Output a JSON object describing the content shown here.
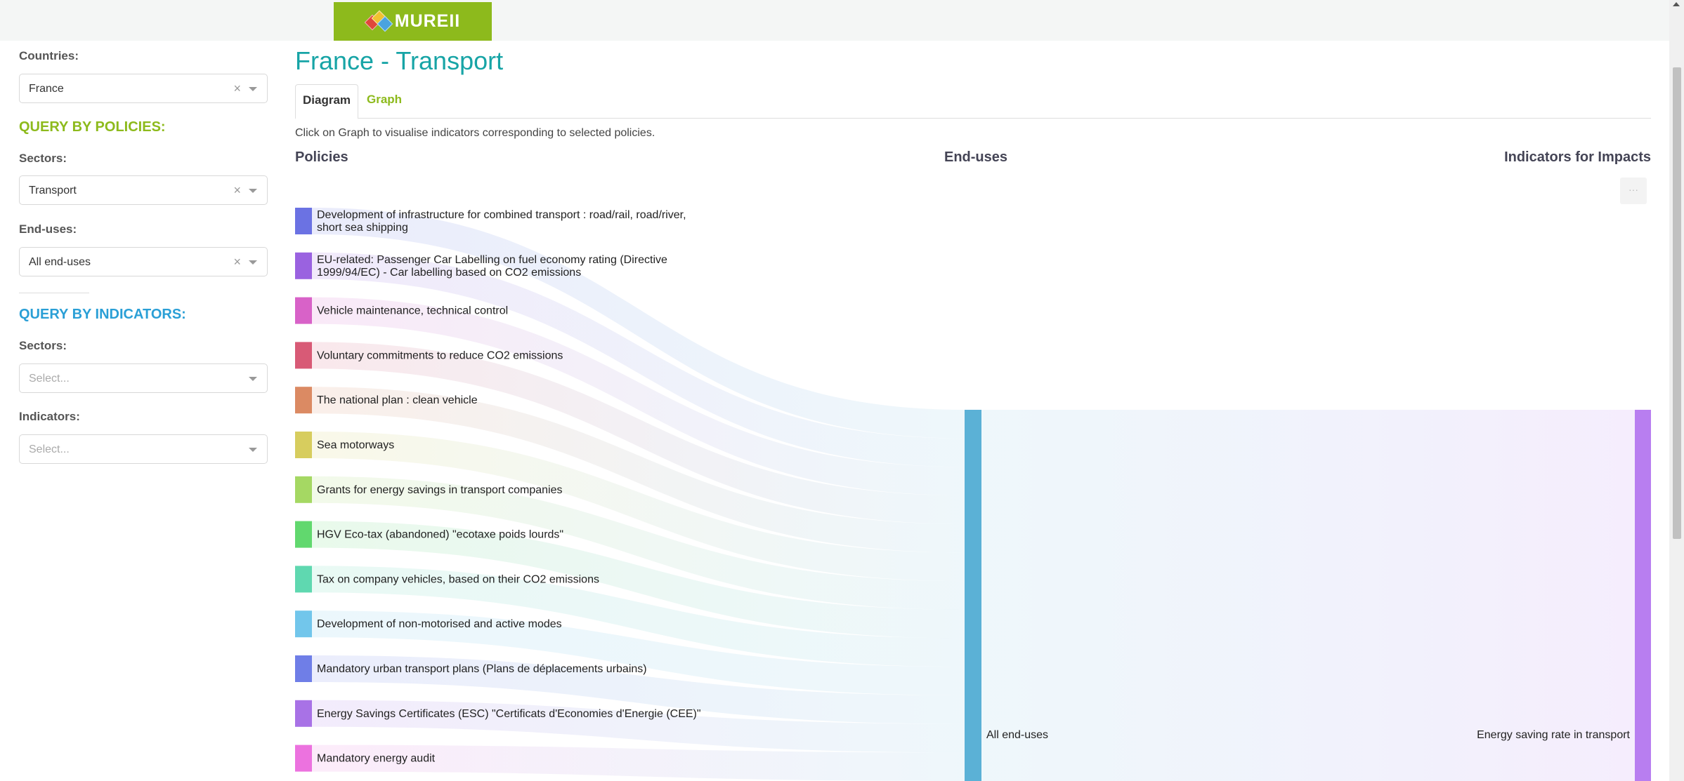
{
  "app": {
    "logo_text": "MUREII"
  },
  "sidebar": {
    "countries_label": "Countries:",
    "countries_value": "France",
    "policies_section": "QUERY BY POLICIES:",
    "sectors_label": "Sectors:",
    "sectors_value": "Transport",
    "enduses_label": "End-uses:",
    "enduses_value": "All end-uses",
    "indicators_section": "QUERY BY INDICATORS:",
    "ind_sectors_label": "Sectors:",
    "ind_sectors_placeholder": "Select...",
    "indicators_label": "Indicators:",
    "indicators_placeholder": "Select...",
    "clear_glyph": "×",
    "colors": {
      "policies_section": "#8dba1c",
      "indicators_section": "#2a9fd6"
    }
  },
  "main": {
    "title": "France - Transport",
    "tabs": [
      {
        "label": "Diagram"
      },
      {
        "label": "Graph"
      }
    ],
    "hint": "Click on Graph to visualise indicators corresponding to selected policies.",
    "col_policies": "Policies",
    "col_enduses": "End-uses",
    "col_indicators": "Indicators for Impacts",
    "button_glyph": "···"
  },
  "sankey": {
    "policies": [
      {
        "label": "Development of infrastructure for combined transport : road/rail, road/river,",
        "label2": "short sea shipping",
        "color": "#6b72e3"
      },
      {
        "label": "EU-related: Passenger Car Labelling on fuel economy rating (Directive",
        "label2": "1999/94/EC) - Car labelling based on CO2 emissions",
        "color": "#9a62e0"
      },
      {
        "label": "Vehicle maintenance, technical control",
        "color": "#d862c8"
      },
      {
        "label": "Voluntary commitments to reduce CO2 emissions",
        "color": "#d85a76"
      },
      {
        "label": "The national plan : clean vehicle",
        "color": "#db8a63"
      },
      {
        "label": "Sea motorways",
        "color": "#d7cd5e"
      },
      {
        "label": "Grants for energy savings in transport companies",
        "color": "#a5d863"
      },
      {
        "label": "HGV Eco-tax (abandoned) \"ecotaxe poids lourds\"",
        "color": "#61d86e"
      },
      {
        "label": "Tax on company vehicles, based on their CO2 emissions",
        "color": "#5fd8b0"
      },
      {
        "label": "Development of non-motorised and active modes",
        "color": "#72c6eb"
      },
      {
        "label": "Mandatory urban transport plans (Plans de déplacements urbains)",
        "color": "#6f7ee7"
      },
      {
        "label": "Energy Savings Certificates (ESC) \"Certificats d'Economies d'Energie (CEE)\"",
        "color": "#a872e6"
      },
      {
        "label": "Mandatory energy audit",
        "color": "#ec72df"
      }
    ],
    "enduse": {
      "label": "All end-uses",
      "color": "#5bb1d6"
    },
    "indicator": {
      "label": "Energy saving rate in transport",
      "color": "#b87ef0"
    }
  }
}
